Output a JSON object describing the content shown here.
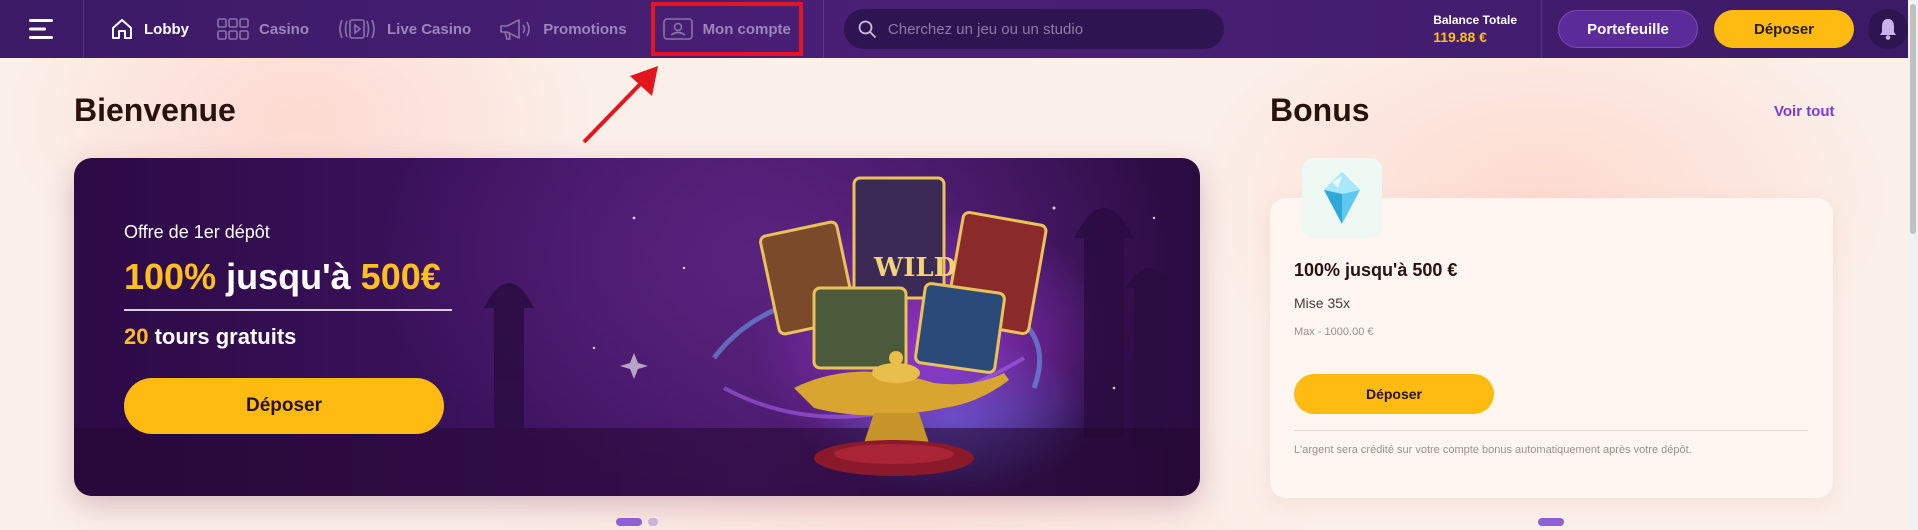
{
  "header": {
    "nav": [
      {
        "label": "Lobby",
        "icon": "home-icon",
        "active": true
      },
      {
        "label": "Casino",
        "icon": "grid-icon",
        "active": false
      },
      {
        "label": "Live Casino",
        "icon": "play-icon",
        "active": false
      },
      {
        "label": "Promotions",
        "icon": "megaphone-icon",
        "active": false
      },
      {
        "label": "Mon compte",
        "icon": "account-card-icon",
        "active": false
      }
    ],
    "search_placeholder": "Cherchez un jeu ou un studio",
    "balance_label": "Balance Totale",
    "balance_value": "119.88 €",
    "wallet_label": "Portefeuille",
    "deposit_label": "Déposer"
  },
  "welcome": {
    "title": "Bienvenue",
    "offer_subtitle": "Offre de 1er dépôt",
    "offer_pct": "100%",
    "offer_mid": " jusqu'à ",
    "offer_amount": "500€",
    "spins_count": "20",
    "spins_text": " tours gratuits",
    "cta": "Déposer"
  },
  "bonus": {
    "title": "Bonus",
    "see_all": "Voir tout",
    "name": "100% jusqu'à 500 €",
    "wager": "Mise 35x",
    "max": "Max - 1000.00 €",
    "cta": "Déposer",
    "note": "L'argent sera crédité sur votre compte bonus automatiquement après votre dépôt."
  },
  "colors": {
    "header_bg": "#4a2077",
    "accent_yellow": "#ffbb12",
    "highlight_red": "#e3161d",
    "link_purple": "#7a3bd6"
  }
}
